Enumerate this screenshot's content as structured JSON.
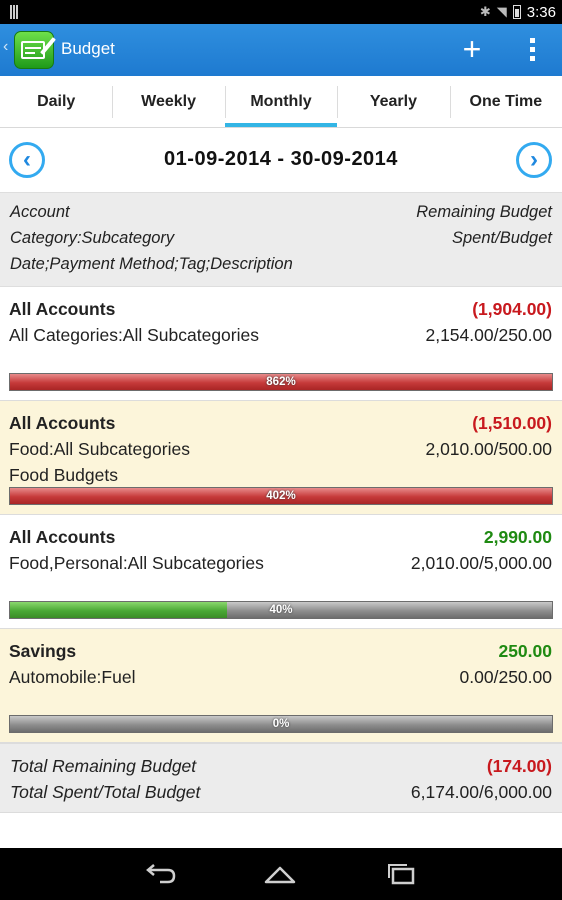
{
  "status_bar": {
    "time": "3:36",
    "icons": [
      "notification-bars-icon",
      "bluetooth-icon",
      "wifi-icon",
      "battery-icon"
    ]
  },
  "action_bar": {
    "title": "Budget",
    "icons": [
      "back-caret-icon",
      "budget-app-icon",
      "add-icon",
      "overflow-menu-icon"
    ],
    "color": "#2386d6"
  },
  "tabs": [
    {
      "label": "Daily",
      "active": false
    },
    {
      "label": "Weekly",
      "active": false
    },
    {
      "label": "Monthly",
      "active": true
    },
    {
      "label": "Yearly",
      "active": false
    },
    {
      "label": "One Time",
      "active": false
    }
  ],
  "period": {
    "range": "01-09-2014 - 30-09-2014",
    "prev_icon": "chevron-left-circle-icon",
    "next_icon": "chevron-right-circle-icon"
  },
  "legend": {
    "left_line1": "Account",
    "left_line2": "Category:Subcategory",
    "left_line3": "Date;Payment Method;Tag;Description",
    "right_line1": "Remaining Budget",
    "right_line2": "Spent/Budget"
  },
  "budgets": [
    {
      "account": "All Accounts",
      "remaining": "(1,904.00)",
      "category": "All Categories:All Subcategories",
      "spent_budget": "2,154.00/250.00",
      "description": "",
      "percent_label": "862%",
      "progress": 1.0,
      "status": "over"
    },
    {
      "account": "All Accounts",
      "remaining": "(1,510.00)",
      "category": "Food:All Subcategories",
      "spent_budget": "2,010.00/500.00",
      "description": "Food Budgets",
      "percent_label": "402%",
      "progress": 1.0,
      "status": "over"
    },
    {
      "account": "All Accounts",
      "remaining": "2,990.00",
      "category": "Food,Personal:All Subcategories",
      "spent_budget": "2,010.00/5,000.00",
      "description": "",
      "percent_label": "40%",
      "progress": 0.4,
      "status": "under"
    },
    {
      "account": "Savings",
      "remaining": "250.00",
      "category": "Automobile:Fuel",
      "spent_budget": "0.00/250.00",
      "description": "",
      "percent_label": "0%",
      "progress": 0.0,
      "status": "under"
    }
  ],
  "totals": {
    "remaining_label": "Total Remaining Budget",
    "remaining_value": "(174.00)",
    "spent_label": "Total Spent/Total Budget",
    "spent_value": "6,174.00/6,000.00"
  },
  "colors": {
    "negative": "#c8191e",
    "positive": "#1f8a12",
    "tab_indicator": "#33b5e5",
    "cream_row": "#fcf5da"
  },
  "nav_bar": {
    "icons": [
      "back-icon",
      "home-icon",
      "recent-apps-icon"
    ]
  }
}
